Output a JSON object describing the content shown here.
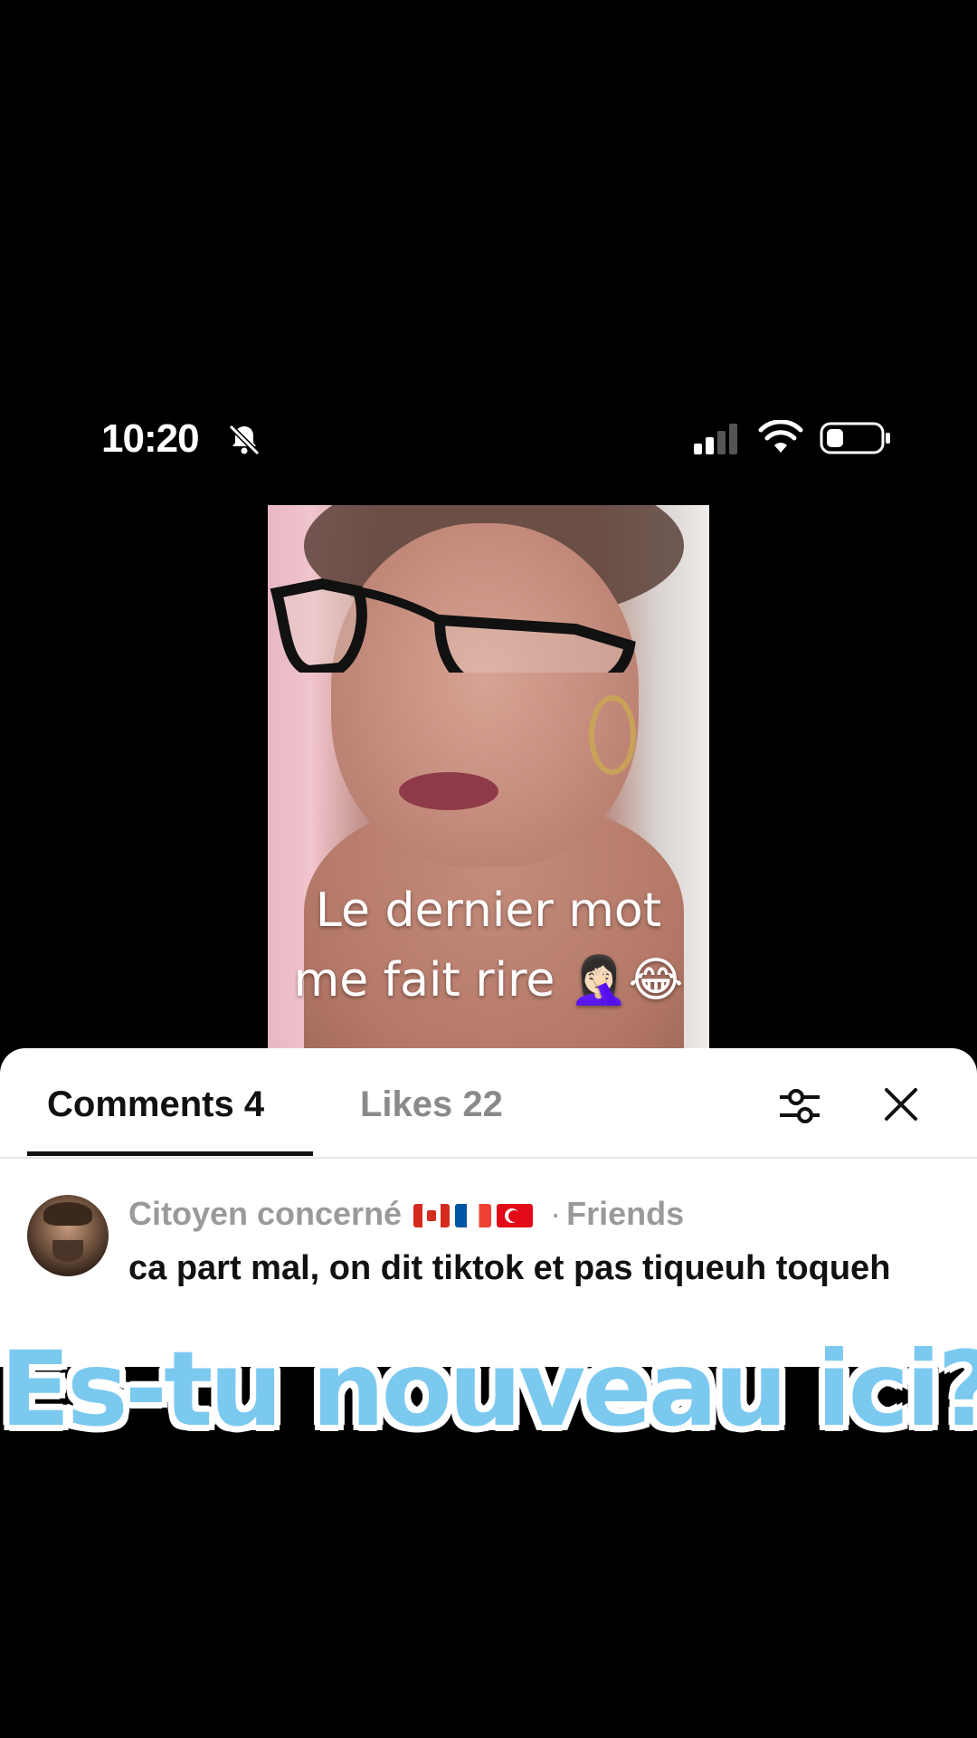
{
  "status_bar": {
    "time": "10:20",
    "bell_icon": "bell-slash-icon",
    "signal_icon": "cellular-signal-icon",
    "wifi_icon": "wifi-icon",
    "battery_icon": "battery-low-icon"
  },
  "video": {
    "caption_line1": "Le dernier mot",
    "caption_line2": "me fait rire 🤦🏻‍♀️😂"
  },
  "sheet": {
    "tabs": [
      {
        "label": "Comments 4",
        "active": true
      },
      {
        "label": "Likes 22",
        "active": false
      }
    ],
    "filter_icon": "sliders-icon",
    "close_icon": "close-icon"
  },
  "comments": [
    {
      "author": "Citoyen concerné",
      "flags": [
        "canada",
        "france",
        "turkey"
      ],
      "relation": "Friends",
      "text": "ca part mal, on dit tiktok et pas tiqueuh toqueh"
    }
  ],
  "overlay": {
    "banner": "Es-tu nouveau ici?"
  },
  "colors": {
    "banner_fill": "#7cc9f0",
    "background": "#000000",
    "sheet": "#ffffff"
  }
}
